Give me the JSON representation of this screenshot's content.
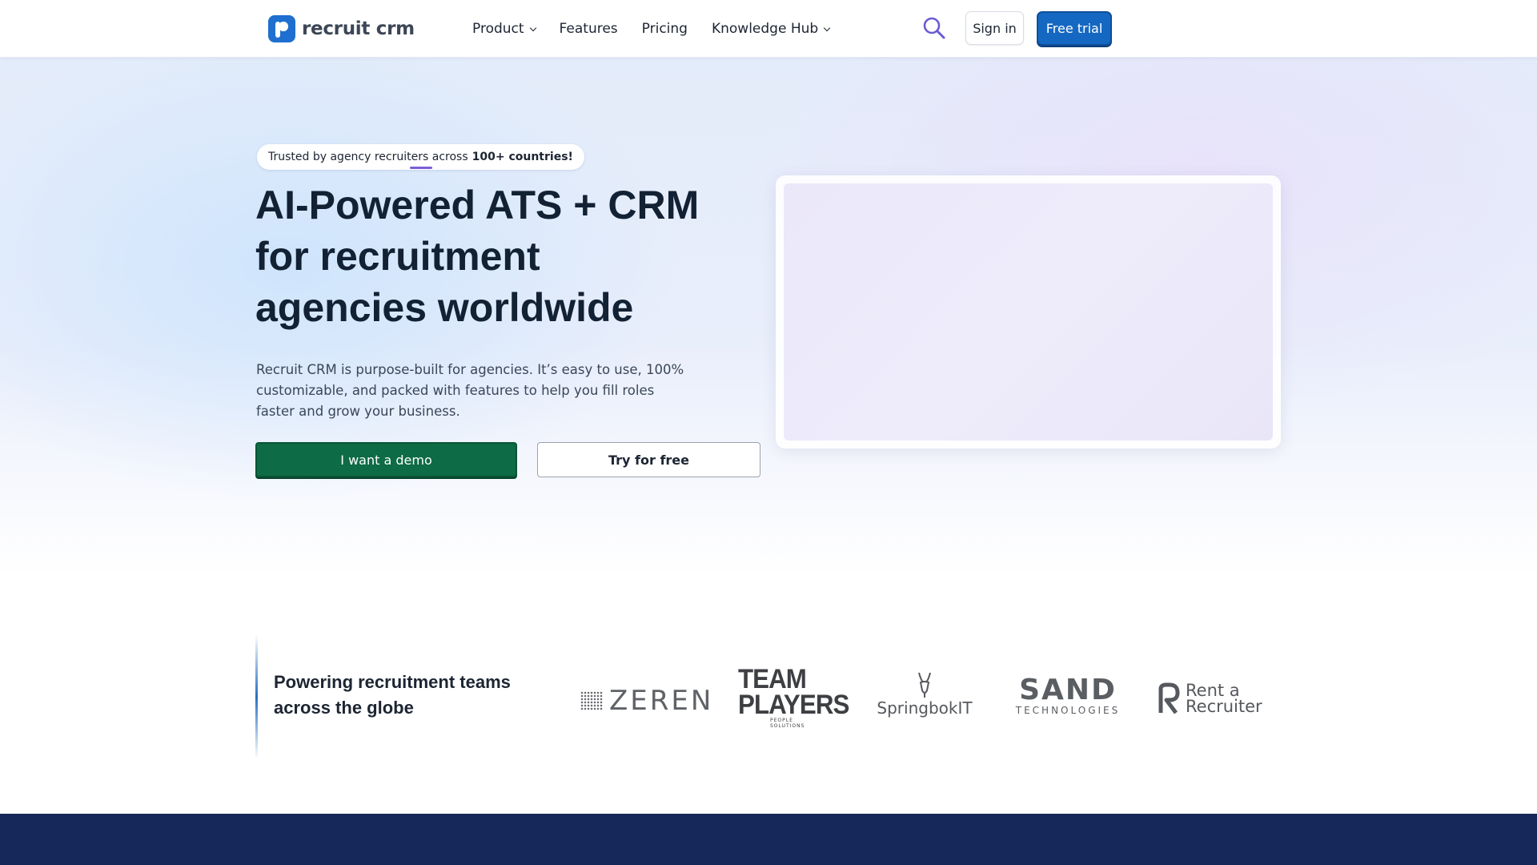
{
  "brand": {
    "name": "recruit crm",
    "accent": "#1e6fcf",
    "demo_green": "#0d6b45",
    "navy": "#16285a"
  },
  "nav": {
    "items": [
      {
        "label": "Product",
        "dropdown": true
      },
      {
        "label": "Features",
        "dropdown": false
      },
      {
        "label": "Pricing",
        "dropdown": false
      },
      {
        "label": "Knowledge Hub",
        "dropdown": true
      }
    ],
    "search_icon": "search-icon",
    "sign_in": "Sign in",
    "free_trial": "Free trial"
  },
  "hero": {
    "trust_prefix": "Trusted by agency recruiters across",
    "trust_bold": "100+ countries!",
    "title": "AI-Powered ATS + CRM for recruitment agencies worldwide",
    "subtitle": "Recruit CRM is purpose-built for agencies. It’s easy to use, 100% customizable, and packed with features to help you fill roles faster and grow your business.",
    "demo_button": "I want a demo",
    "try_button": "Try for free"
  },
  "logos": {
    "heading": "Powering recruitment teams across the globe",
    "clients": [
      {
        "name": "ZEREN"
      },
      {
        "name": "TEAM PLAYERS",
        "sub": "PEOPLE SOLUTIONS"
      },
      {
        "name": "SpringbokIT"
      },
      {
        "name": "SAND",
        "sub": "TECHNOLOGIES"
      },
      {
        "name": "Rent a Recruiter"
      }
    ]
  }
}
